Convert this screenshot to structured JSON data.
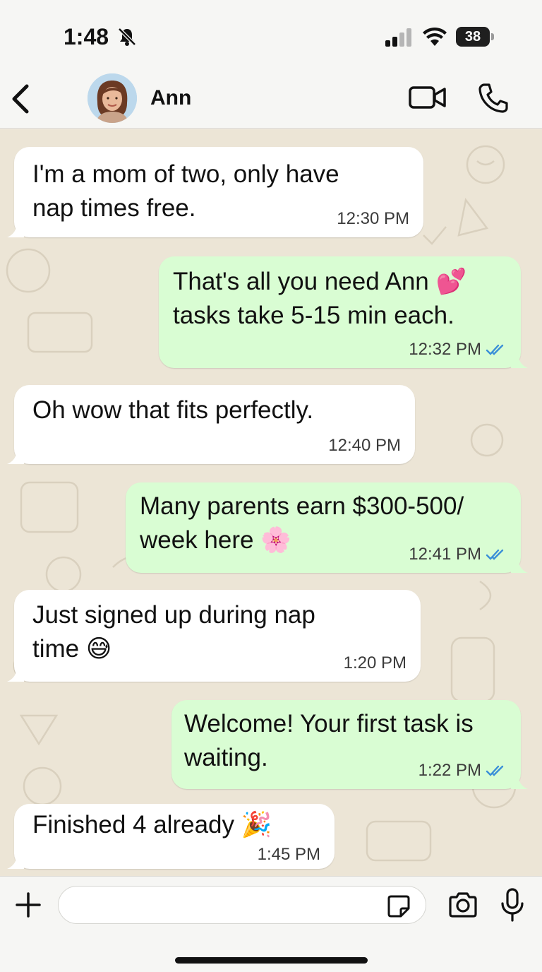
{
  "status_bar": {
    "time": "1:48",
    "battery": "38"
  },
  "header": {
    "contact_name": "Ann"
  },
  "messages": [
    {
      "direction": "in",
      "text": "I'm a mom of two, only have\nnap times free.",
      "time": "12:30 PM"
    },
    {
      "direction": "out",
      "text": "That's all you need Ann 💕\ntasks take 5-15 min each.",
      "time": "12:32 PM",
      "status": "read"
    },
    {
      "direction": "in",
      "text": "Oh wow that fits perfectly.",
      "time": "12:40 PM"
    },
    {
      "direction": "out",
      "text": "Many parents earn $300-500/\nweek here 🌸",
      "time": "12:41 PM",
      "status": "read"
    },
    {
      "direction": "in",
      "text": "Just signed up during nap\ntime 😅",
      "time": "1:20 PM"
    },
    {
      "direction": "out",
      "text": "Welcome! Your first task is\nwaiting.",
      "time": "1:22 PM",
      "status": "read"
    },
    {
      "direction": "in",
      "text": "Finished 4 already 🎉",
      "time": "1:45 PM"
    }
  ],
  "input": {
    "value": "",
    "placeholder": ""
  },
  "colors": {
    "incoming_bubble": "#ffffff",
    "outgoing_bubble": "#d9fdd3",
    "read_ticks": "#3a8fd8",
    "wallpaper": "#ece5d6"
  },
  "icons": {
    "status": [
      "bell-slash-icon",
      "signal-icon",
      "wifi-icon",
      "battery-icon"
    ],
    "header": [
      "back-chevron-icon",
      "video-call-icon",
      "phone-icon"
    ],
    "input": [
      "plus-icon",
      "sticker-icon",
      "camera-icon",
      "microphone-icon"
    ]
  }
}
